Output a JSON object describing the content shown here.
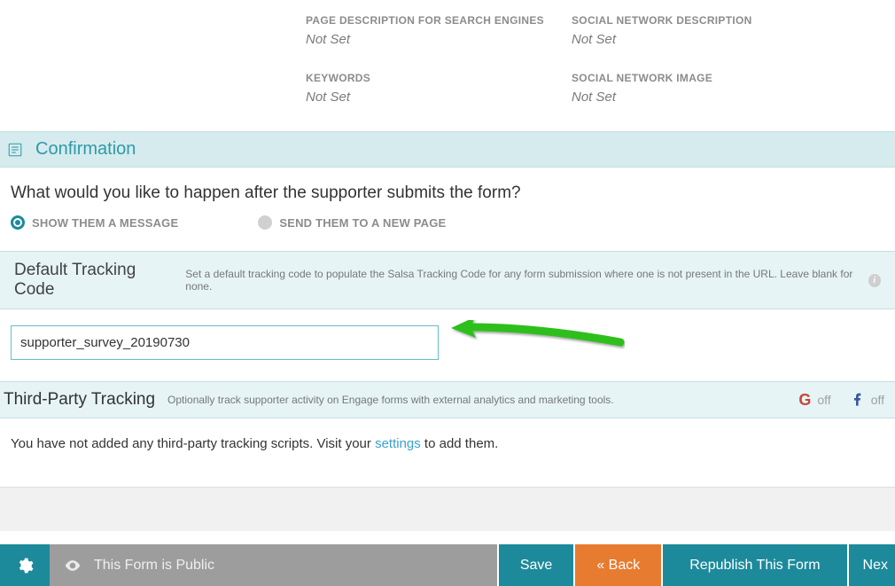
{
  "meta": {
    "page_desc": {
      "label": "PAGE DESCRIPTION FOR SEARCH ENGINES",
      "value": "Not Set"
    },
    "social_desc": {
      "label": "SOCIAL NETWORK DESCRIPTION",
      "value": "Not Set"
    },
    "keywords": {
      "label": "KEYWORDS",
      "value": "Not Set"
    },
    "social_image": {
      "label": "SOCIAL NETWORK IMAGE",
      "value": "Not Set"
    }
  },
  "confirmation": {
    "title": "Confirmation",
    "question": "What would you like to happen after the supporter submits the form?",
    "option_show": "SHOW THEM A MESSAGE",
    "option_send": "SEND THEM TO A NEW PAGE"
  },
  "default_tracking": {
    "title": "Default Tracking Code",
    "subtitle": "Set a default tracking code to populate the Salsa Tracking Code for any form submission where one is not present in the URL. Leave blank for none.",
    "value": "supporter_survey_20190730"
  },
  "third_party": {
    "title": "Third-Party Tracking",
    "subtitle": "Optionally track supporter activity on Engage forms with external analytics and marketing tools.",
    "google_state": "off",
    "facebook_state": "off",
    "body_before": "You have not added any third-party tracking scripts. Visit your ",
    "body_link": "settings",
    "body_after": " to add them."
  },
  "footer": {
    "public": "This Form is Public",
    "save": "Save",
    "back": "« Back",
    "republish": "Republish This Form",
    "next": "Nex"
  }
}
